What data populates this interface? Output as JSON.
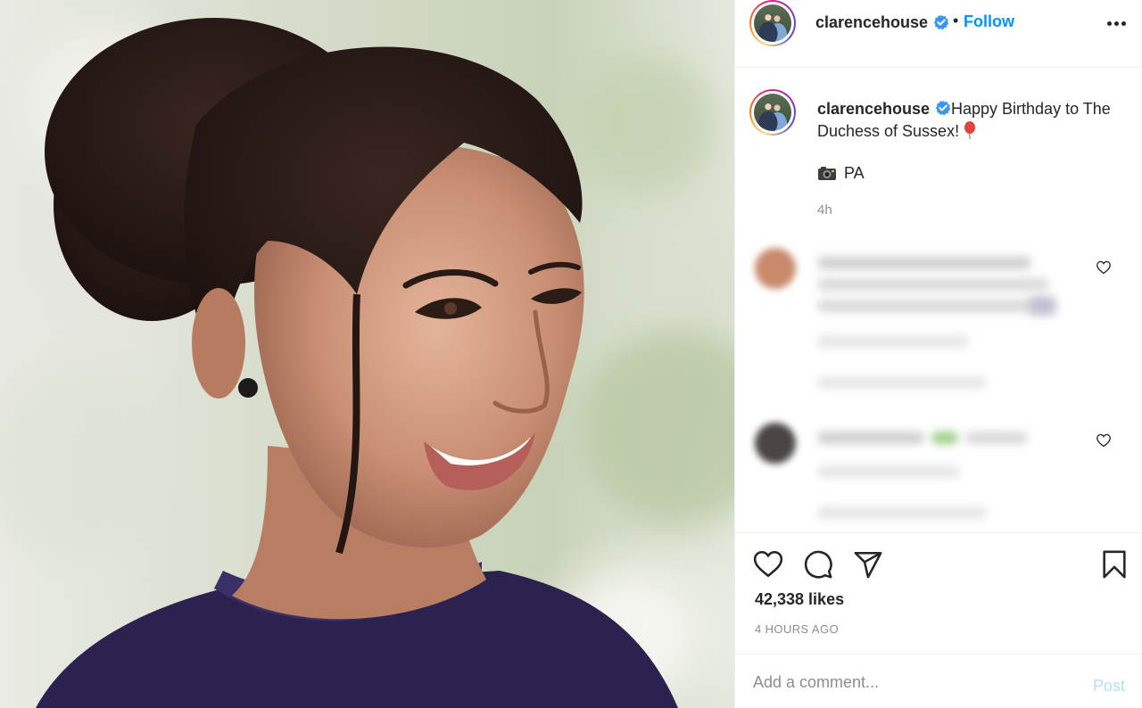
{
  "post": {
    "author": "clarencehouse",
    "follow_label": "Follow",
    "separator": "•",
    "caption": "Happy Birthday to The Duchess of Sussex!",
    "photo_credit": "PA",
    "time_ago": "4h",
    "likes": "42,338 likes",
    "timestamp": "4 HOURS AGO"
  },
  "comment_box": {
    "placeholder": "Add a comment...",
    "post_label": "Post"
  },
  "icons": {
    "more": "more-options-icon",
    "verified": "verified-badge-icon",
    "balloon": "balloon-emoji-icon",
    "camera": "camera-emoji-icon",
    "like": "heart-icon",
    "comment": "comment-icon",
    "share": "share-icon",
    "save": "bookmark-icon"
  },
  "colors": {
    "accent": "#0095f6",
    "verified": "#3897f0",
    "muted": "#8e8e8e",
    "post_disabled": "#b2dffc"
  }
}
